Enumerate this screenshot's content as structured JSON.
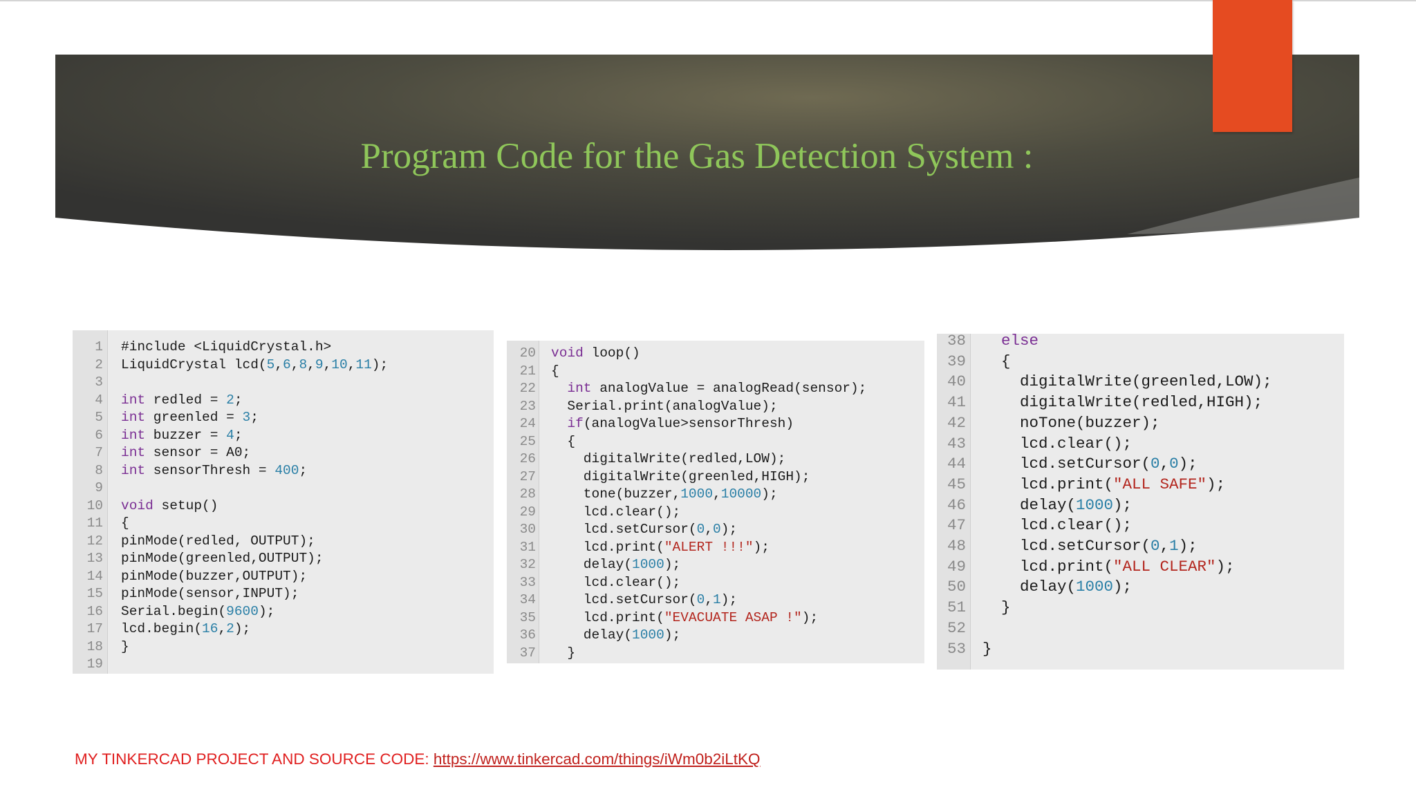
{
  "slide": {
    "title": "Program Code for the Gas Detection System :",
    "accent_color": "#e54b21",
    "title_color": "#8fc65a"
  },
  "panels": [
    {
      "name": "code-panel-setup",
      "lines": [
        {
          "n": "1",
          "t": [
            [
              "",
              "#include <LiquidCrystal.h>"
            ]
          ]
        },
        {
          "n": "2",
          "t": [
            [
              "",
              "LiquidCrystal lcd("
            ],
            [
              "num",
              "5"
            ],
            [
              "",
              ","
            ],
            [
              "num",
              "6"
            ],
            [
              "",
              ","
            ],
            [
              "num",
              "8"
            ],
            [
              "",
              ","
            ],
            [
              "num",
              "9"
            ],
            [
              "",
              ","
            ],
            [
              "num",
              "10"
            ],
            [
              "",
              ","
            ],
            [
              "num",
              "11"
            ],
            [
              "",
              ");"
            ]
          ]
        },
        {
          "n": "3",
          "t": []
        },
        {
          "n": "4",
          "t": [
            [
              "kw",
              "int"
            ],
            [
              "",
              " redled = "
            ],
            [
              "num",
              "2"
            ],
            [
              "",
              ";"
            ]
          ]
        },
        {
          "n": "5",
          "t": [
            [
              "kw",
              "int"
            ],
            [
              "",
              " greenled = "
            ],
            [
              "num",
              "3"
            ],
            [
              "",
              ";"
            ]
          ]
        },
        {
          "n": "6",
          "t": [
            [
              "kw",
              "int"
            ],
            [
              "",
              " buzzer = "
            ],
            [
              "num",
              "4"
            ],
            [
              "",
              ";"
            ]
          ]
        },
        {
          "n": "7",
          "t": [
            [
              "kw",
              "int"
            ],
            [
              "",
              " sensor = A0;"
            ]
          ]
        },
        {
          "n": "8",
          "t": [
            [
              "kw",
              "int"
            ],
            [
              "",
              " sensorThresh = "
            ],
            [
              "num",
              "400"
            ],
            [
              "",
              ";"
            ]
          ]
        },
        {
          "n": "9",
          "t": []
        },
        {
          "n": "10",
          "t": [
            [
              "kw",
              "void"
            ],
            [
              "",
              " setup()"
            ]
          ]
        },
        {
          "n": "11",
          "t": [
            [
              "",
              "{"
            ]
          ]
        },
        {
          "n": "12",
          "t": [
            [
              "",
              "pinMode(redled, OUTPUT);"
            ]
          ]
        },
        {
          "n": "13",
          "t": [
            [
              "",
              "pinMode(greenled,OUTPUT);"
            ]
          ]
        },
        {
          "n": "14",
          "t": [
            [
              "",
              "pinMode(buzzer,OUTPUT);"
            ]
          ]
        },
        {
          "n": "15",
          "t": [
            [
              "",
              "pinMode(sensor,INPUT);"
            ]
          ]
        },
        {
          "n": "16",
          "t": [
            [
              "",
              "Serial.begin("
            ],
            [
              "num",
              "9600"
            ],
            [
              "",
              ");"
            ]
          ]
        },
        {
          "n": "17",
          "t": [
            [
              "",
              "lcd.begin("
            ],
            [
              "num",
              "16"
            ],
            [
              "",
              ","
            ],
            [
              "num",
              "2"
            ],
            [
              "",
              ");"
            ]
          ]
        },
        {
          "n": "18",
          "t": [
            [
              "",
              "}"
            ]
          ]
        },
        {
          "n": "19",
          "t": []
        }
      ]
    },
    {
      "name": "code-panel-loop",
      "lines": [
        {
          "n": "20",
          "t": [
            [
              "kw",
              "void"
            ],
            [
              "",
              " loop()"
            ]
          ]
        },
        {
          "n": "21",
          "t": [
            [
              "",
              "{"
            ]
          ]
        },
        {
          "n": "22",
          "t": [
            [
              "",
              "  "
            ],
            [
              "kw",
              "int"
            ],
            [
              "",
              " analogValue = analogRead(sensor);"
            ]
          ]
        },
        {
          "n": "23",
          "t": [
            [
              "",
              "  Serial.print(analogValue);"
            ]
          ]
        },
        {
          "n": "24",
          "t": [
            [
              "",
              "  "
            ],
            [
              "kw",
              "if"
            ],
            [
              "",
              "(analogValue>sensorThresh)"
            ]
          ]
        },
        {
          "n": "25",
          "t": [
            [
              "",
              "  {"
            ]
          ]
        },
        {
          "n": "26",
          "t": [
            [
              "",
              "    digitalWrite(redled,LOW);"
            ]
          ]
        },
        {
          "n": "27",
          "t": [
            [
              "",
              "    digitalWrite(greenled,HIGH);"
            ]
          ]
        },
        {
          "n": "28",
          "t": [
            [
              "",
              "    tone(buzzer,"
            ],
            [
              "num",
              "1000"
            ],
            [
              "",
              ","
            ],
            [
              "num",
              "10000"
            ],
            [
              "",
              ");"
            ]
          ]
        },
        {
          "n": "29",
          "t": [
            [
              "",
              "    lcd.clear();"
            ]
          ]
        },
        {
          "n": "30",
          "t": [
            [
              "",
              "    lcd.setCursor("
            ],
            [
              "num",
              "0"
            ],
            [
              "",
              ","
            ],
            [
              "num",
              "0"
            ],
            [
              "",
              ");"
            ]
          ]
        },
        {
          "n": "31",
          "t": [
            [
              "",
              "    lcd.print("
            ],
            [
              "str",
              "\"ALERT !!!\""
            ],
            [
              "",
              ");"
            ]
          ]
        },
        {
          "n": "32",
          "t": [
            [
              "",
              "    delay("
            ],
            [
              "num",
              "1000"
            ],
            [
              "",
              ");"
            ]
          ]
        },
        {
          "n": "33",
          "t": [
            [
              "",
              "    lcd.clear();"
            ]
          ]
        },
        {
          "n": "34",
          "t": [
            [
              "",
              "    lcd.setCursor("
            ],
            [
              "num",
              "0"
            ],
            [
              "",
              ","
            ],
            [
              "num",
              "1"
            ],
            [
              "",
              ");"
            ]
          ]
        },
        {
          "n": "35",
          "t": [
            [
              "",
              "    lcd.print("
            ],
            [
              "str",
              "\"EVACUATE ASAP !\""
            ],
            [
              "",
              ");"
            ]
          ]
        },
        {
          "n": "36",
          "t": [
            [
              "",
              "    delay("
            ],
            [
              "num",
              "1000"
            ],
            [
              "",
              ");"
            ]
          ]
        },
        {
          "n": "37",
          "t": [
            [
              "",
              "  }"
            ]
          ]
        }
      ]
    },
    {
      "name": "code-panel-else",
      "lines": [
        {
          "n": "38",
          "t": [
            [
              "",
              "  "
            ],
            [
              "kw",
              "else"
            ]
          ]
        },
        {
          "n": "39",
          "t": [
            [
              "",
              "  {"
            ]
          ]
        },
        {
          "n": "40",
          "t": [
            [
              "",
              "    digitalWrite(greenled,LOW);"
            ]
          ]
        },
        {
          "n": "41",
          "t": [
            [
              "",
              "    digitalWrite(redled,HIGH);"
            ]
          ]
        },
        {
          "n": "42",
          "t": [
            [
              "",
              "    noTone(buzzer);"
            ]
          ]
        },
        {
          "n": "43",
          "t": [
            [
              "",
              "    lcd.clear();"
            ]
          ]
        },
        {
          "n": "44",
          "t": [
            [
              "",
              "    lcd.setCursor("
            ],
            [
              "num",
              "0"
            ],
            [
              "",
              ","
            ],
            [
              "num",
              "0"
            ],
            [
              "",
              ");"
            ]
          ]
        },
        {
          "n": "45",
          "t": [
            [
              "",
              "    lcd.print("
            ],
            [
              "str",
              "\"ALL SAFE\""
            ],
            [
              "",
              ");"
            ]
          ]
        },
        {
          "n": "46",
          "t": [
            [
              "",
              "    delay("
            ],
            [
              "num",
              "1000"
            ],
            [
              "",
              ");"
            ]
          ]
        },
        {
          "n": "47",
          "t": [
            [
              "",
              "    lcd.clear();"
            ]
          ]
        },
        {
          "n": "48",
          "t": [
            [
              "",
              "    lcd.setCursor("
            ],
            [
              "num",
              "0"
            ],
            [
              "",
              ","
            ],
            [
              "num",
              "1"
            ],
            [
              "",
              ");"
            ]
          ]
        },
        {
          "n": "49",
          "t": [
            [
              "",
              "    lcd.print("
            ],
            [
              "str",
              "\"ALL CLEAR\""
            ],
            [
              "",
              ");"
            ]
          ]
        },
        {
          "n": "50",
          "t": [
            [
              "",
              "    delay("
            ],
            [
              "num",
              "1000"
            ],
            [
              "",
              ");"
            ]
          ]
        },
        {
          "n": "51",
          "t": [
            [
              "",
              "  }"
            ]
          ]
        },
        {
          "n": "52",
          "t": []
        },
        {
          "n": "53",
          "t": [
            [
              "",
              "}"
            ]
          ]
        }
      ]
    }
  ],
  "footer": {
    "label": "MY TINKERCAD PROJECT AND SOURCE CODE: ",
    "link_text": "https://www.tinkercad.com/things/iWm0b2iLtKQ"
  }
}
